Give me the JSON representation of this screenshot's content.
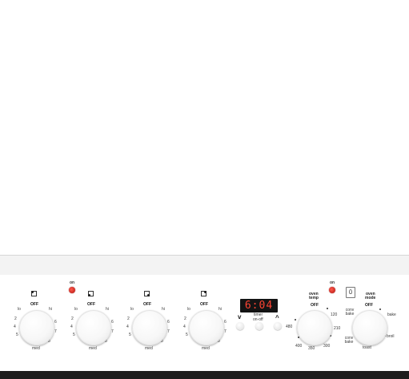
{
  "oven": {
    "burners": [
      {
        "off": "OFF",
        "lo": "lo",
        "hi": "hi",
        "med": "med",
        "nums": [
          "2",
          "3",
          "4",
          "5",
          "6",
          "7",
          "8"
        ]
      },
      {
        "off": "OFF",
        "lo": "lo",
        "hi": "hi",
        "med": "med",
        "nums": [
          "2",
          "3",
          "4",
          "5",
          "6",
          "7",
          "8"
        ]
      },
      {
        "off": "OFF",
        "lo": "lo",
        "hi": "hi",
        "med": "med",
        "nums": [
          "2",
          "3",
          "4",
          "5",
          "6",
          "7",
          "8"
        ]
      },
      {
        "off": "OFF",
        "lo": "lo",
        "hi": "hi",
        "med": "med",
        "nums": [
          "2",
          "3",
          "4",
          "5",
          "6",
          "7",
          "8"
        ]
      }
    ],
    "indicator_on_1": "on",
    "indicator_on_2": "on",
    "clock": {
      "time": "6:04",
      "down_label": "v",
      "up_label": "^",
      "timer_label_1": "timer",
      "timer_label_2": "on-off"
    },
    "oven_temp": {
      "title_1": "oven",
      "title_2": "temp",
      "off": "OFF",
      "values": [
        "120",
        "210",
        "300",
        "350",
        "400",
        "480"
      ]
    },
    "oven_mode": {
      "title_1": "oven",
      "title_2": "mode",
      "off": "OFF",
      "options": [
        "conv bake",
        "bake",
        "broil",
        "conv bake",
        "toast"
      ]
    },
    "colors": {
      "led": "#d01a12",
      "display_text": "#ff4433"
    }
  }
}
